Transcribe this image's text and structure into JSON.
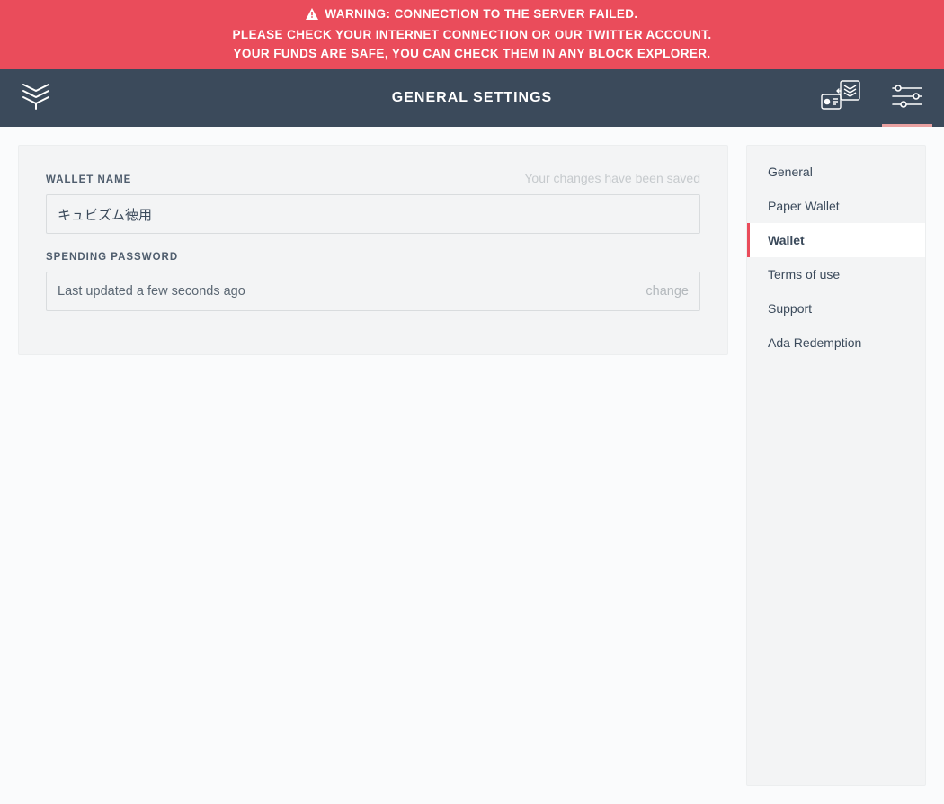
{
  "banner": {
    "line1_prefix": "WARNING: CONNECTION TO THE SERVER FAILED.",
    "line2_prefix": "PLEASE CHECK YOUR INTERNET CONNECTION OR ",
    "line2_link": "OUR TWITTER ACCOUNT",
    "line2_suffix": ".",
    "line3": "YOUR FUNDS ARE SAFE, YOU CAN CHECK THEM IN ANY BLOCK EXPLORER."
  },
  "header": {
    "title": "GENERAL SETTINGS"
  },
  "form": {
    "wallet_name_label": "WALLET NAME",
    "saved_hint": "Your changes have been saved",
    "wallet_name_value": "キュビズム徳用",
    "spending_password_label": "SPENDING PASSWORD",
    "spending_password_updated": "Last updated a few seconds ago",
    "spending_password_change": "change"
  },
  "sidebar": {
    "items": [
      {
        "label": "General",
        "active": false
      },
      {
        "label": "Paper Wallet",
        "active": false
      },
      {
        "label": "Wallet",
        "active": true
      },
      {
        "label": "Terms of use",
        "active": false
      },
      {
        "label": "Support",
        "active": false
      },
      {
        "label": "Ada Redemption",
        "active": false
      }
    ]
  },
  "icons": {
    "logo": "daedalus-logo-icon",
    "warning": "warning-triangle-icon",
    "redeem": "ada-redemption-icon",
    "settings": "settings-sliders-icon"
  },
  "colors": {
    "danger": "#ea4c5b",
    "header_bg": "#3b4a5b",
    "panel_bg": "#f3f4f5",
    "page_bg": "#fafbfc",
    "active_tab_underline": "#e9a1a1"
  }
}
